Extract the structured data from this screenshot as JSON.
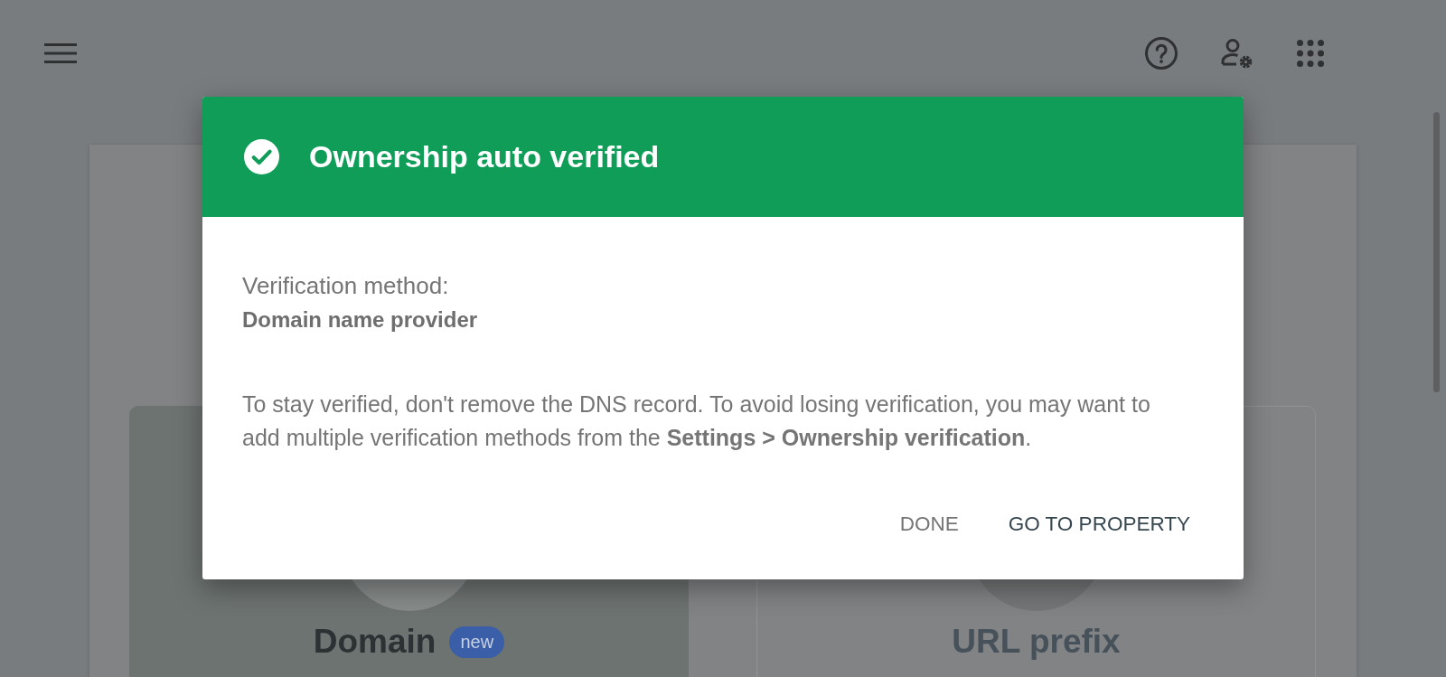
{
  "property_types": [
    {
      "title": "Domain",
      "badge": "new",
      "selected": true
    },
    {
      "title": "URL prefix",
      "selected": false
    }
  ],
  "dialog": {
    "title": "Ownership auto verified",
    "method_label": "Verification method:",
    "method_value": "Domain name provider",
    "message": "To stay verified, don't remove the DNS record. To avoid losing verification, you may want to add multiple verification methods from the **Settings > Ownership verification**.",
    "buttons": [
      {
        "label": "DONE",
        "kind": "dismiss"
      },
      {
        "label": "GO TO PROPERTY",
        "kind": "confirm"
      }
    ]
  }
}
